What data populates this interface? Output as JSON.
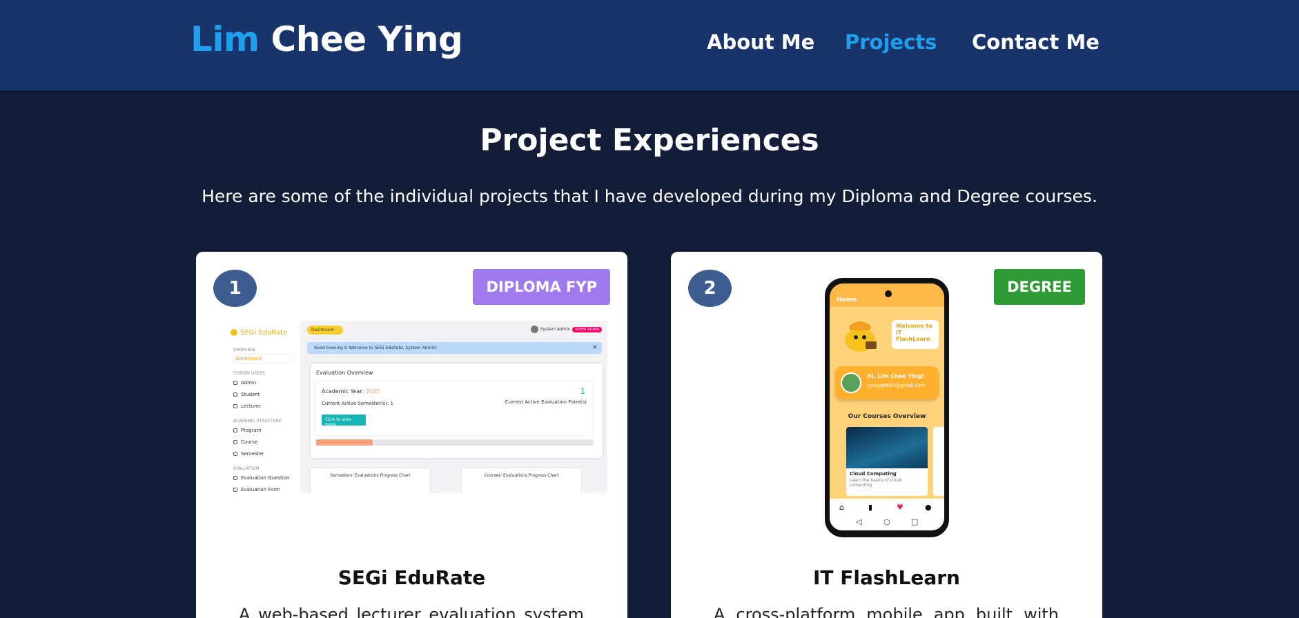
{
  "header": {
    "brand_first": "Lim",
    "brand_last": "Chee Ying",
    "nav": [
      {
        "label": "About Me"
      },
      {
        "label": "Projects",
        "active": true
      },
      {
        "label": "Contact Me"
      }
    ]
  },
  "section": {
    "title": "Project Experiences",
    "subtitle": "Here are some of the individual projects that I have developed during my Diploma and Degree courses."
  },
  "projects": [
    {
      "number": "1",
      "tag": "DIPLOMA FYP",
      "tag_color": "#9f7aee",
      "title": "SEGi EduRate",
      "description": "A web-based lecturer evaluation system",
      "screenshot": {
        "logo": "SEGi EduRate",
        "sidebar": {
          "overview": "OVERVIEW",
          "dashboard": "Dashboard",
          "system_users": "SYSTEM USERS",
          "admin": "Admin",
          "student": "Student",
          "lecturer": "Lecturer",
          "academic": "ACADEMIC STRUCTURE",
          "program": "Program",
          "course": "Course",
          "semester": "Semester",
          "evaluation": "EVALUATION",
          "eval_question": "Evaluation Question",
          "eval_form": "Evaluation Form"
        },
        "breadcrumb": "Dashboard",
        "user": "System Admin",
        "role_badge": "SUPER ADMIN",
        "banner": "Good Evening & Welcome to SEGi EduRate, System Admin!",
        "panel_title": "Evaluation Overview",
        "academic_year_label": "Academic Year:",
        "academic_year": "2025",
        "count": "1",
        "active_semesters": "Current Active Semester(s): 1",
        "active_forms": "Current Active Evaluation Form(s)",
        "button": "Click to view more",
        "chart1": "Semesters' Evaluations Progress Chart",
        "chart2": "Courses' Evaluations Progress Chart"
      }
    },
    {
      "number": "2",
      "tag": "DEGREE",
      "tag_color": "#2f9b36",
      "title": "IT FlashLearn",
      "description": "A cross-platform mobile app built with",
      "screenshot": {
        "screen_title": "Home",
        "welcome": "Welcome to IT FlashLearn",
        "greeting": "Hi, Lim Chee Ying!",
        "email": "cyingg6660@gmail.com",
        "courses_heading": "Our Courses Overview",
        "course_title": "Cloud Computing",
        "course_desc": "Learn the basics of cloud computing."
      }
    }
  ]
}
